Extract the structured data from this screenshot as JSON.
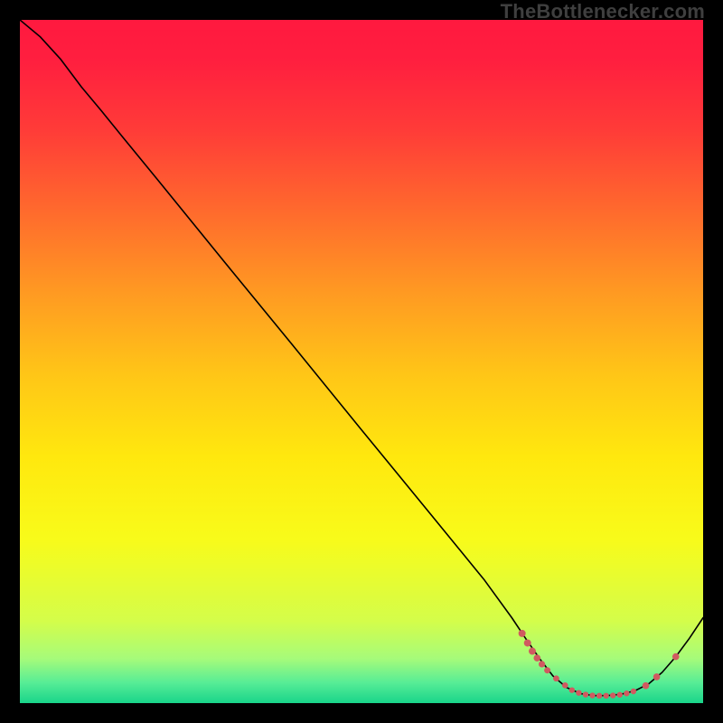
{
  "watermark": "TheBottlenecker.com",
  "chart_data": {
    "type": "line",
    "title": "",
    "xlabel": "",
    "ylabel": "",
    "xlim": [
      0,
      100
    ],
    "ylim": [
      0,
      100
    ],
    "background_gradient_stops": [
      {
        "offset": 0.0,
        "color": "#ff193f"
      },
      {
        "offset": 0.06,
        "color": "#ff1f3f"
      },
      {
        "offset": 0.16,
        "color": "#ff3b38"
      },
      {
        "offset": 0.28,
        "color": "#ff6a2d"
      },
      {
        "offset": 0.4,
        "color": "#ff9a22"
      },
      {
        "offset": 0.52,
        "color": "#ffc617"
      },
      {
        "offset": 0.64,
        "color": "#ffe80e"
      },
      {
        "offset": 0.76,
        "color": "#f8fb1a"
      },
      {
        "offset": 0.88,
        "color": "#d4fd4a"
      },
      {
        "offset": 0.935,
        "color": "#a6fb7a"
      },
      {
        "offset": 0.97,
        "color": "#57ed96"
      },
      {
        "offset": 1.0,
        "color": "#19d48a"
      }
    ],
    "series": [
      {
        "name": "curve",
        "stroke": "#000000",
        "stroke_width": 1.6,
        "points": [
          {
            "x": 0.0,
            "y": 100.0
          },
          {
            "x": 3.0,
            "y": 97.5
          },
          {
            "x": 6.0,
            "y": 94.2
          },
          {
            "x": 9.0,
            "y": 90.2
          },
          {
            "x": 12.0,
            "y": 86.6
          },
          {
            "x": 15.0,
            "y": 82.9
          },
          {
            "x": 20.0,
            "y": 76.8
          },
          {
            "x": 30.0,
            "y": 64.5
          },
          {
            "x": 40.0,
            "y": 52.3
          },
          {
            "x": 50.0,
            "y": 40.0
          },
          {
            "x": 60.0,
            "y": 27.8
          },
          {
            "x": 68.0,
            "y": 18.0
          },
          {
            "x": 72.0,
            "y": 12.5
          },
          {
            "x": 74.0,
            "y": 9.5
          },
          {
            "x": 76.0,
            "y": 6.6
          },
          {
            "x": 78.0,
            "y": 4.0
          },
          {
            "x": 80.0,
            "y": 2.3
          },
          {
            "x": 82.0,
            "y": 1.4
          },
          {
            "x": 84.0,
            "y": 1.1
          },
          {
            "x": 86.0,
            "y": 1.1
          },
          {
            "x": 88.0,
            "y": 1.3
          },
          {
            "x": 90.0,
            "y": 1.8
          },
          {
            "x": 92.0,
            "y": 2.8
          },
          {
            "x": 94.0,
            "y": 4.5
          },
          {
            "x": 96.0,
            "y": 6.8
          },
          {
            "x": 98.0,
            "y": 9.5
          },
          {
            "x": 100.0,
            "y": 12.5
          }
        ]
      },
      {
        "name": "markers",
        "fill": "#d05a60",
        "points": [
          {
            "x": 73.5,
            "y": 10.2,
            "r": 4.0
          },
          {
            "x": 74.3,
            "y": 8.8,
            "r": 4.0
          },
          {
            "x": 75.0,
            "y": 7.6,
            "r": 4.0
          },
          {
            "x": 75.7,
            "y": 6.6,
            "r": 3.8
          },
          {
            "x": 76.4,
            "y": 5.7,
            "r": 3.6
          },
          {
            "x": 77.2,
            "y": 4.8,
            "r": 3.5
          },
          {
            "x": 78.5,
            "y": 3.6,
            "r": 3.4
          },
          {
            "x": 79.8,
            "y": 2.6,
            "r": 3.3
          },
          {
            "x": 80.8,
            "y": 1.9,
            "r": 3.2
          },
          {
            "x": 81.8,
            "y": 1.5,
            "r": 3.2
          },
          {
            "x": 82.8,
            "y": 1.25,
            "r": 3.2
          },
          {
            "x": 83.8,
            "y": 1.12,
            "r": 3.2
          },
          {
            "x": 84.8,
            "y": 1.08,
            "r": 3.2
          },
          {
            "x": 85.8,
            "y": 1.08,
            "r": 3.2
          },
          {
            "x": 86.8,
            "y": 1.12,
            "r": 3.2
          },
          {
            "x": 87.8,
            "y": 1.22,
            "r": 3.2
          },
          {
            "x": 88.8,
            "y": 1.42,
            "r": 3.2
          },
          {
            "x": 89.8,
            "y": 1.72,
            "r": 3.2
          },
          {
            "x": 91.6,
            "y": 2.55,
            "r": 3.8
          },
          {
            "x": 93.2,
            "y": 3.85,
            "r": 3.8
          },
          {
            "x": 96.0,
            "y": 6.8,
            "r": 3.8
          }
        ]
      }
    ]
  }
}
